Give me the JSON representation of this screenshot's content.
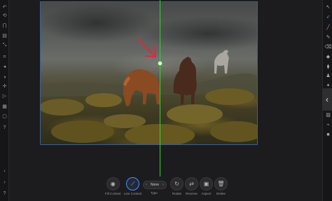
{
  "left_tools": [
    {
      "icon": "undo-icon",
      "glyph": "↶"
    },
    {
      "icon": "history-icon",
      "glyph": "⟲"
    },
    {
      "icon": "magnet-icon",
      "glyph": "⋂"
    },
    {
      "icon": "layers-icon",
      "glyph": "▤"
    },
    {
      "icon": "scale-icon",
      "glyph": "⤡"
    },
    {
      "icon": "crop-icon",
      "glyph": "⌗"
    },
    {
      "icon": "volume-icon",
      "glyph": "◂"
    },
    {
      "icon": "adjust-icon",
      "glyph": "◑"
    },
    {
      "icon": "transform-icon",
      "glyph": "✢"
    },
    {
      "icon": "play-icon",
      "glyph": "▷"
    },
    {
      "icon": "grid-icon",
      "glyph": "▦"
    },
    {
      "icon": "document-icon",
      "glyph": "▢"
    },
    {
      "icon": "help-icon",
      "glyph": "?"
    },
    {
      "icon": "chevron-left-icon",
      "glyph": "‹"
    },
    {
      "icon": "chevron-right-icon",
      "glyph": "›"
    },
    {
      "icon": "info-icon",
      "glyph": "?"
    }
  ],
  "right_tools": [
    {
      "icon": "move-tool-icon",
      "glyph": "↖",
      "active": false
    },
    {
      "icon": "pointer-tool-icon",
      "glyph": "➶",
      "active": true
    },
    {
      "icon": "brush-tool-icon",
      "glyph": "╱",
      "active": false
    },
    {
      "icon": "pencil-tool-icon",
      "glyph": "✎",
      "active": false
    },
    {
      "icon": "eraser-tool-icon",
      "glyph": "⌫",
      "active": false
    },
    {
      "icon": "fill-tool-icon",
      "glyph": "◆",
      "active": false
    },
    {
      "icon": "smudge-tool-icon",
      "glyph": "⧫",
      "active": false
    },
    {
      "icon": "stamp-tool-icon",
      "glyph": "♟",
      "active": false
    },
    {
      "icon": "retouch-tool-icon",
      "glyph": "✦",
      "active": false
    },
    {
      "icon": "gradient-tool-icon",
      "glyph": "▨",
      "active": false
    },
    {
      "icon": "eyedropper-tool-icon",
      "glyph": "⌁",
      "active": false
    },
    {
      "icon": "color-swatch-icon",
      "glyph": "■",
      "active": false
    }
  ],
  "collapse_glyph": "‹",
  "toolbar": {
    "fill_context": {
      "label": "Fill Context",
      "icon": "fill-context-icon",
      "glyph": "◉"
    },
    "line_context": {
      "label": "Line Context",
      "icon": "line-context-icon",
      "glyph": "⟋"
    },
    "type": {
      "label": "Type",
      "value": "None",
      "left_glyph": "‹",
      "right_glyph": "›"
    },
    "rotate": {
      "label": "Rotate",
      "icon": "rotate-icon",
      "glyph": "↻"
    },
    "reverse": {
      "label": "Reverse",
      "icon": "reverse-icon",
      "glyph": "⇄"
    },
    "aspect": {
      "label": "Aspect",
      "icon": "aspect-icon",
      "glyph": "▣"
    },
    "delete": {
      "label": "Delete",
      "icon": "trash-icon",
      "glyph": "🗑"
    }
  },
  "colors": {
    "guide": "#2fd62f",
    "accent": "#4a8cff",
    "arrow": "#e0283c"
  }
}
